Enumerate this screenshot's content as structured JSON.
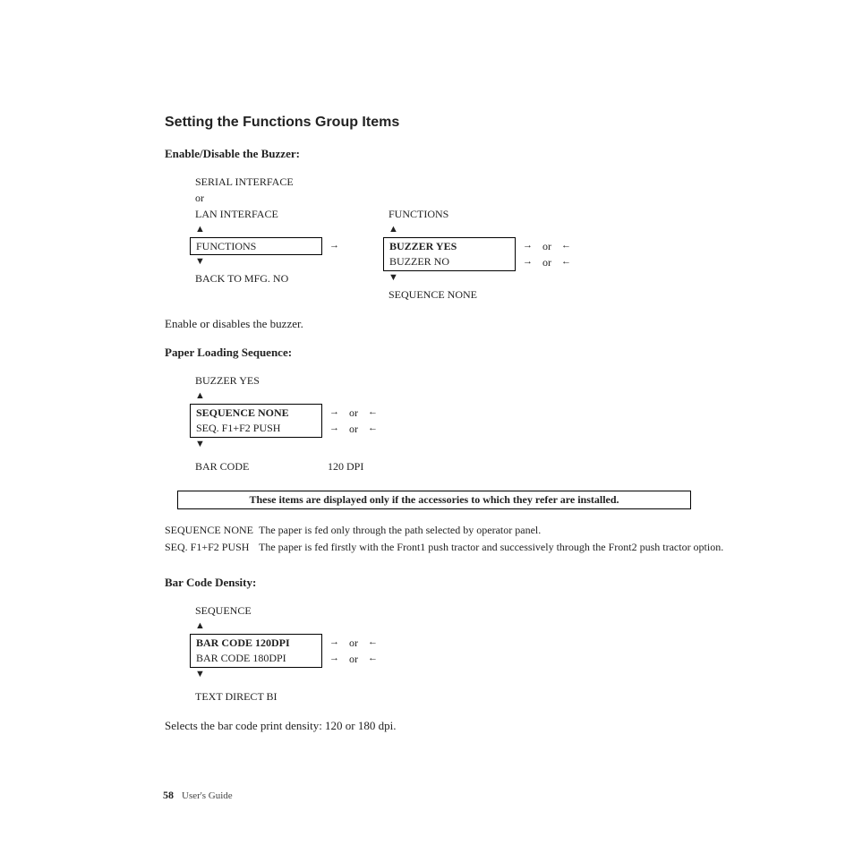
{
  "heading": "Setting the Functions Group Items",
  "section1": {
    "title": "Enable/Disable the Buzzer:",
    "left": {
      "line1": "SERIAL INTERFACE",
      "or": "or",
      "line2": "LAN INTERFACE",
      "boxed": "FUNCTIONS",
      "after": "BACK TO MFG. NO"
    },
    "right": {
      "top": "FUNCTIONS",
      "boxed1": "BUZZER YES",
      "boxed2": "BUZZER NO",
      "after": "SEQUENCE NONE"
    },
    "desc": "Enable or disables the buzzer."
  },
  "section2": {
    "title": "Paper Loading Sequence:",
    "top": "BUZZER YES",
    "boxed1": "SEQUENCE NONE",
    "boxed2": "SEQ. F1+F2 PUSH",
    "after": "BAR CODE",
    "after_right": "120 DPI",
    "note": "These items are displayed only if the accessories to which they refer are installed.",
    "defs": [
      {
        "term": "SEQUENCE NONE",
        "text": "The paper is fed only through the path selected by operator panel."
      },
      {
        "term": "SEQ. F1+F2 PUSH",
        "text": "The paper is fed firstly with the Front1 push tractor and successively through the Front2 push tractor option."
      }
    ]
  },
  "section3": {
    "title": "Bar Code Density:",
    "top": "SEQUENCE",
    "boxed1": "BAR CODE 120DPI",
    "boxed2": "BAR CODE 180DPI",
    "after": "TEXT DIRECT BI",
    "desc": "Selects the bar code print density: 120 or 180 dpi."
  },
  "glyphs": {
    "up": "▲",
    "down": "▼",
    "right": "→",
    "left": "←",
    "or": "or"
  },
  "footer": {
    "page": "58",
    "title": "User's Guide"
  }
}
